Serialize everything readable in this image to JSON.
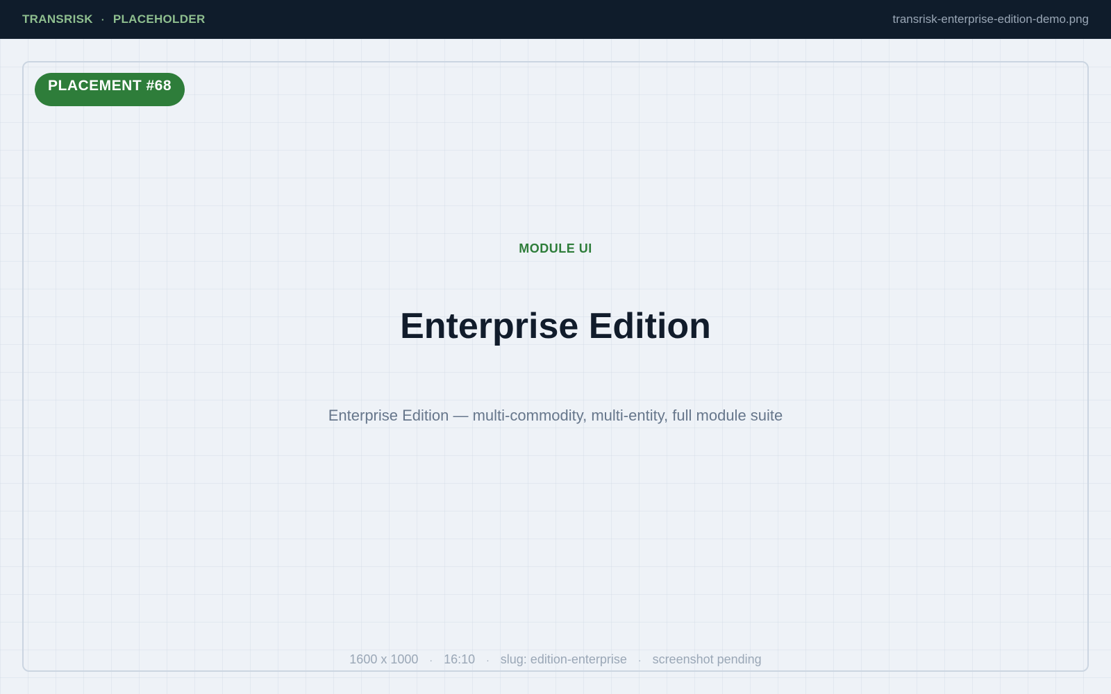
{
  "header": {
    "brand": "TRANSRISK",
    "separator": "·",
    "section": "PLACEHOLDER",
    "filename": "transrisk-enterprise-edition-demo.png"
  },
  "badge": {
    "label": "PLACEMENT #68"
  },
  "content": {
    "eyebrow": "MODULE UI",
    "title": "Enterprise Edition",
    "subtitle": "Enterprise Edition — multi-commodity, multi-entity, full module suite"
  },
  "meta": {
    "dimensions": "1600 x 1000",
    "aspect": "16:10",
    "slug": "slug: edition-enterprise",
    "status": "screenshot pending",
    "separator": "·"
  },
  "colors": {
    "topbar_bg": "#0f1c2b",
    "accent_green": "#2e7d3a",
    "brand_text": "#8fbf8f",
    "page_bg": "#eef2f7",
    "title_text": "#111c2b",
    "muted_text": "#66768b",
    "meta_text": "#9aa7b6"
  }
}
